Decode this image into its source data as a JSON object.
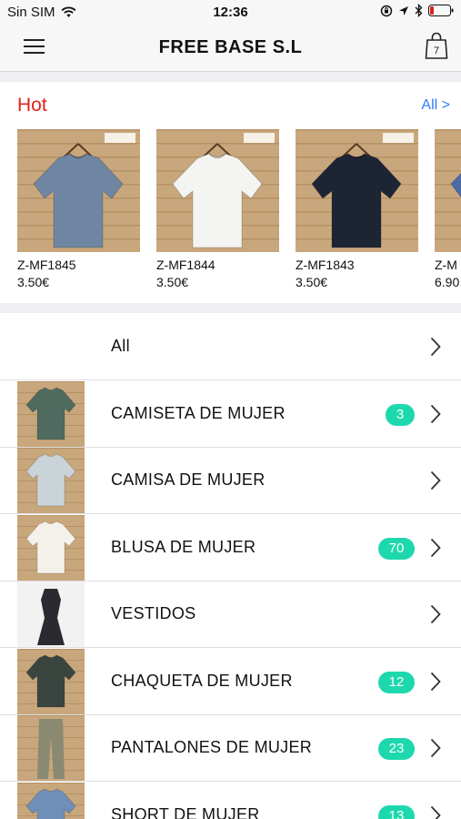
{
  "status_bar": {
    "carrier": "Sin SIM",
    "time": "12:36"
  },
  "header": {
    "title": "FREE BASE S.L",
    "cart_count": "7"
  },
  "hot": {
    "title": "Hot",
    "all_label": "All >",
    "items": [
      {
        "code": "Z-MF1845",
        "price": "3.50€",
        "shirt_color": "#6f86a3",
        "tag": "MF1845"
      },
      {
        "code": "Z-MF1844",
        "price": "3.50€",
        "shirt_color": "#f4f4f2",
        "tag": "MF1844"
      },
      {
        "code": "Z-MF1843",
        "price": "3.50€",
        "shirt_color": "#1d2535",
        "tag": "MF1843"
      },
      {
        "code": "Z-M",
        "price": "6.90",
        "shirt_color": "#4a6aa8",
        "tag": ""
      }
    ]
  },
  "categories": [
    {
      "label": "All",
      "badge": null,
      "thumb": null
    },
    {
      "label": "CAMISETA DE MUJER",
      "badge": "3",
      "thumb": "#4f6b5f"
    },
    {
      "label": "CAMISA DE MUJER",
      "badge": null,
      "thumb": "#c9d3d8"
    },
    {
      "label": "BLUSA DE MUJER",
      "badge": "70",
      "thumb": "#f4f1ea"
    },
    {
      "label": "VESTIDOS",
      "badge": null,
      "thumb": "#2a2a30"
    },
    {
      "label": "CHAQUETA DE MUJER",
      "badge": "12",
      "thumb": "#3a4540"
    },
    {
      "label": "PANTALONES DE MUJER",
      "badge": "23",
      "thumb": "#8a8a72"
    },
    {
      "label": "SHORT DE MUJER",
      "badge": "13",
      "thumb": "#6f8fb8"
    }
  ],
  "colors": {
    "hot_title": "#e2231a",
    "link": "#2f7cf6",
    "badge": "#1ed8ad",
    "wood": "#c9a77c"
  }
}
